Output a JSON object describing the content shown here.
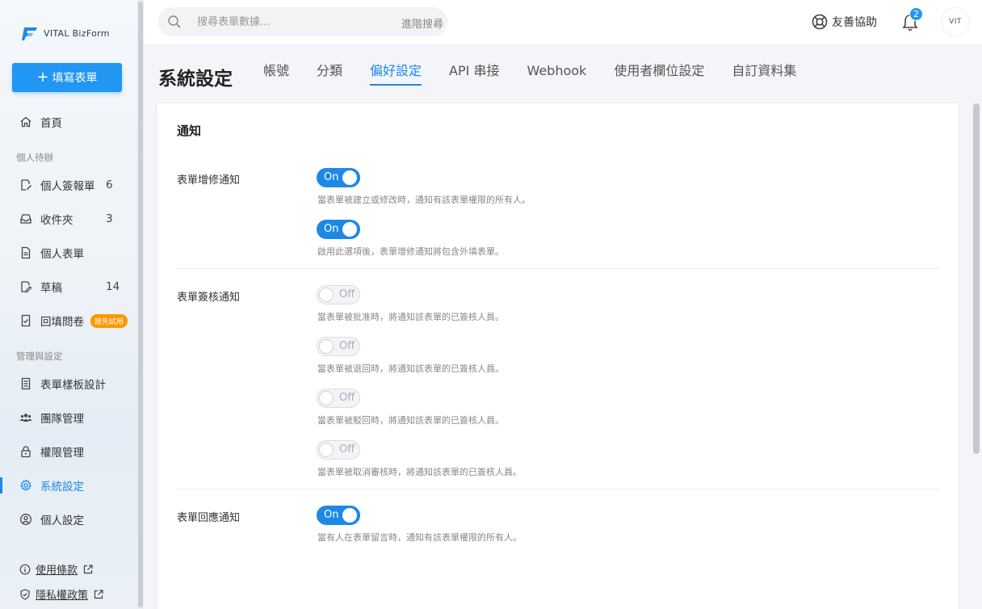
{
  "app": {
    "logo_text": "VITAL BizForm",
    "fill_form_label": "填寫表單",
    "brand_color": "#2196f3"
  },
  "sidebar": {
    "home": "首頁",
    "section_personal": "個人待辦",
    "personal_items": [
      {
        "label": "個人簽報單",
        "count": "6"
      },
      {
        "label": "收件夾",
        "count": "3"
      },
      {
        "label": "個人表單",
        "count": ""
      },
      {
        "label": "草稿",
        "count": "14"
      },
      {
        "label": "回填問卷",
        "badge": "搶先試用"
      }
    ],
    "section_admin": "管理與設定",
    "admin_items": [
      {
        "label": "表單樣板設計"
      },
      {
        "label": "團隊管理"
      },
      {
        "label": "權限管理"
      },
      {
        "label": "系統設定"
      },
      {
        "label": "個人設定"
      }
    ],
    "footer": {
      "terms": "使用條款",
      "privacy": "隱私權政策"
    }
  },
  "topbar": {
    "search_placeholder": "搜尋表單數據...",
    "advanced_search": "進階搜尋",
    "help_label": "友善協助",
    "notification_count": "2",
    "avatar_text": "VIT"
  },
  "page": {
    "title": "系統設定",
    "tabs": [
      "帳號",
      "分類",
      "偏好設定",
      "API 串接",
      "Webhook",
      "使用者欄位設定",
      "自訂資料集"
    ],
    "active_tab": "偏好設定"
  },
  "card": {
    "title": "通知",
    "groups": [
      {
        "label": "表單增修通知",
        "options": [
          {
            "state": "On",
            "desc": "當表單被建立或修改時，通知有該表單權限的所有人。"
          },
          {
            "state": "On",
            "desc": "啟用此選項後，表單增修通知將包含外填表單。"
          }
        ]
      },
      {
        "label": "表單簽核通知",
        "options": [
          {
            "state": "Off",
            "desc": "當表單被批准時，將通知該表單的已簽核人員。"
          },
          {
            "state": "Off",
            "desc": "當表單被退回時，將通知該表單的已簽核人員。"
          },
          {
            "state": "Off",
            "desc": "當表單被駁回時，將通知該表單的已簽核人員。"
          },
          {
            "state": "Off",
            "desc": "當表單被取消審核時，將通知該表單的已簽核人員。"
          }
        ]
      },
      {
        "label": "表單回應通知",
        "options": [
          {
            "state": "On",
            "desc": "當有人在表單留言時，通知有該表單權限的所有人。"
          }
        ]
      }
    ]
  }
}
